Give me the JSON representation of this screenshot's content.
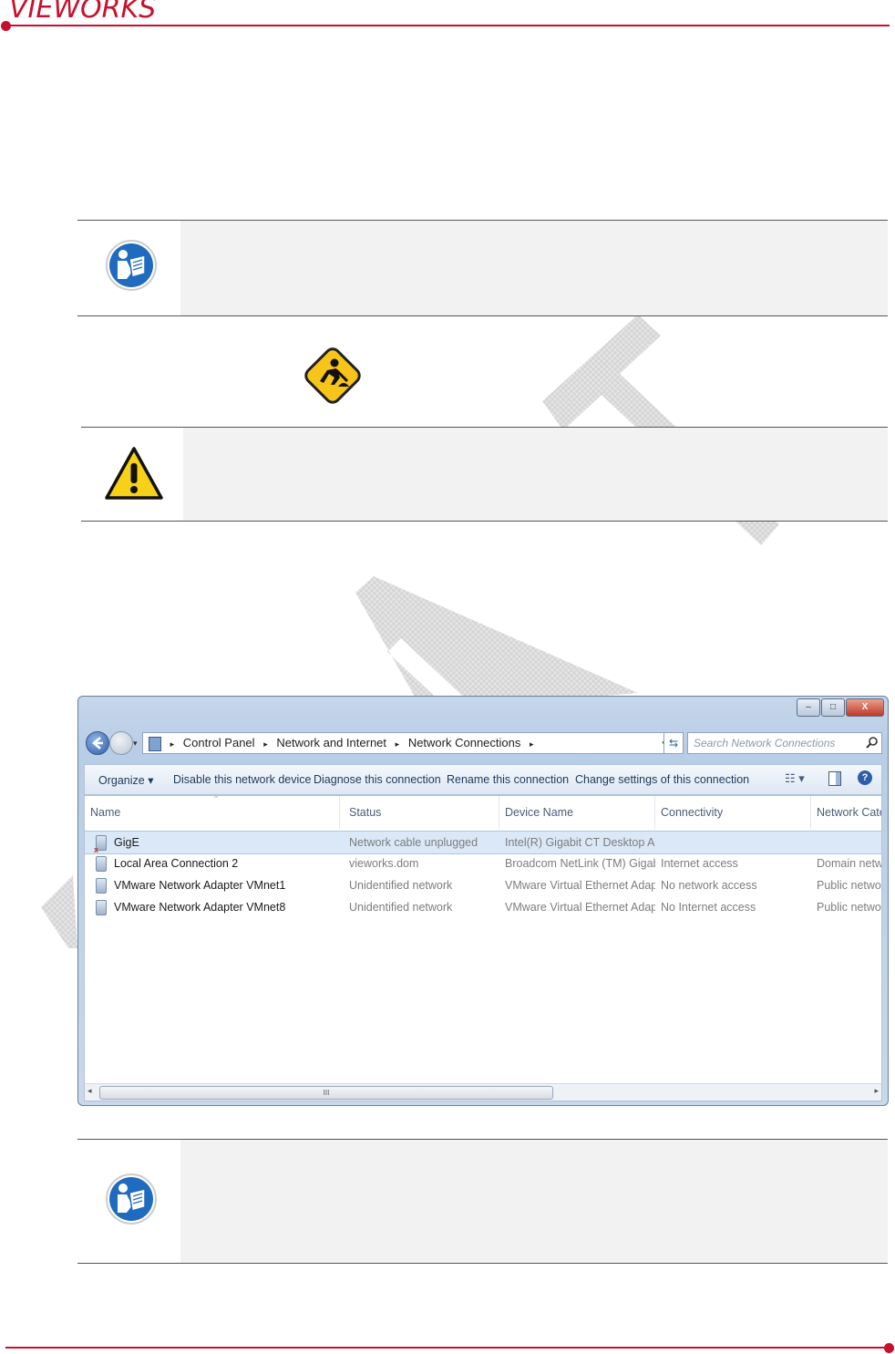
{
  "header": {
    "logo_text": "VIEWORKS"
  },
  "colors": {
    "brand_red": "#c8102e",
    "note_blue": "#1f6bbf",
    "warn_yellow": "#f7d117"
  },
  "icons": {
    "note1": "manual-reading-icon",
    "construction": "under-construction-icon",
    "caution": "caution-triangle-icon",
    "note2": "manual-reading-icon"
  },
  "window": {
    "title_buttons": {
      "minimize": "–",
      "maximize": "□",
      "close": "X"
    },
    "breadcrumb": [
      "Control Panel",
      "Network and Internet",
      "Network Connections"
    ],
    "search_placeholder": "Search Network Connections",
    "toolbar": {
      "organize": "Organize ▾",
      "disable": "Disable this network device",
      "diagnose": "Diagnose this connection",
      "rename": "Rename this connection",
      "change": "Change settings of this connection"
    },
    "columns": [
      "Name",
      "Status",
      "Device Name",
      "Connectivity",
      "Network Categ"
    ],
    "rows": [
      {
        "name": "GigE",
        "status": "Network cable unplugged",
        "device": "Intel(R) Gigabit CT Desktop Ada...",
        "connectivity": "",
        "category": ""
      },
      {
        "name": "Local Area Connection 2",
        "status": "vieworks.dom",
        "device": "Broadcom NetLink (TM) Gigabit...",
        "connectivity": "Internet access",
        "category": "Domain networ"
      },
      {
        "name": "VMware Network Adapter VMnet1",
        "status": "Unidentified network",
        "device": "VMware Virtual Ethernet Adapte...",
        "connectivity": "No network access",
        "category": "Public network"
      },
      {
        "name": "VMware Network Adapter VMnet8",
        "status": "Unidentified network",
        "device": "VMware Virtual Ethernet Adapte...",
        "connectivity": "No Internet access",
        "category": "Public network"
      }
    ],
    "scroll_thumb": "III"
  }
}
